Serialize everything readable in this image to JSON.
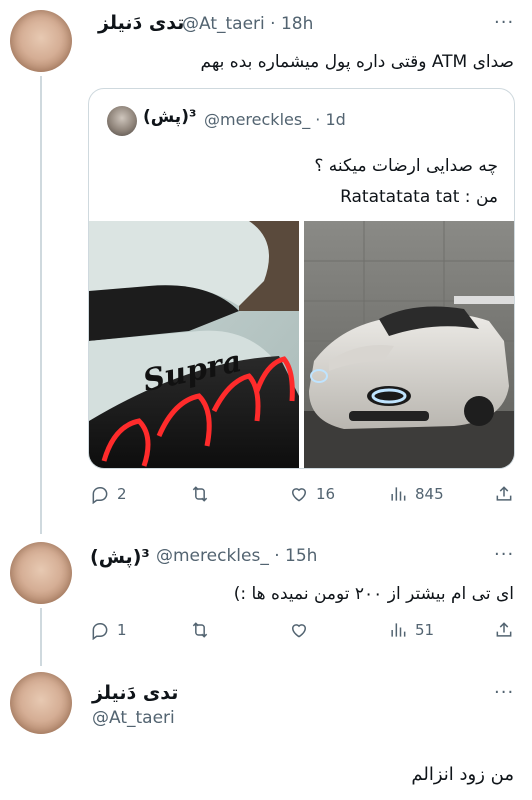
{
  "tweet1": {
    "author_name": "تدی دَنیلز",
    "handle_time": "@At_taeri · 18h",
    "text": "صدای ATM وقتی داره پول میشماره بده بهم",
    "more": "···"
  },
  "quote": {
    "author_name": "(پش)³",
    "handle_time": "@mereckles_ · 1d",
    "line1": "چه صدایی ارضات میکنه ؟",
    "line2": "من : Ratatatata tat",
    "left_image_text": "Supra"
  },
  "tweet1_actions": {
    "replies": "2",
    "retweets": "",
    "likes": "16",
    "views": "845"
  },
  "tweet2": {
    "author_name": "(پش)³",
    "handle_time": "@mereckles_ · 15h",
    "text": "ای تی ام بیشتر از ۲۰۰ تومن نمیده ها :)",
    "more": "···"
  },
  "tweet2_actions": {
    "replies": "1",
    "retweets": "",
    "likes": "",
    "views": "51"
  },
  "tweet3": {
    "author_name": "تدی دَنیلز",
    "handle": "@At_taeri",
    "text": "من زود انزالم",
    "more": "···"
  },
  "icons": {
    "reply": "reply-icon",
    "retweet": "retweet-icon",
    "like": "heart-icon",
    "views": "views-icon",
    "share": "share-icon",
    "more": "more-icon"
  }
}
